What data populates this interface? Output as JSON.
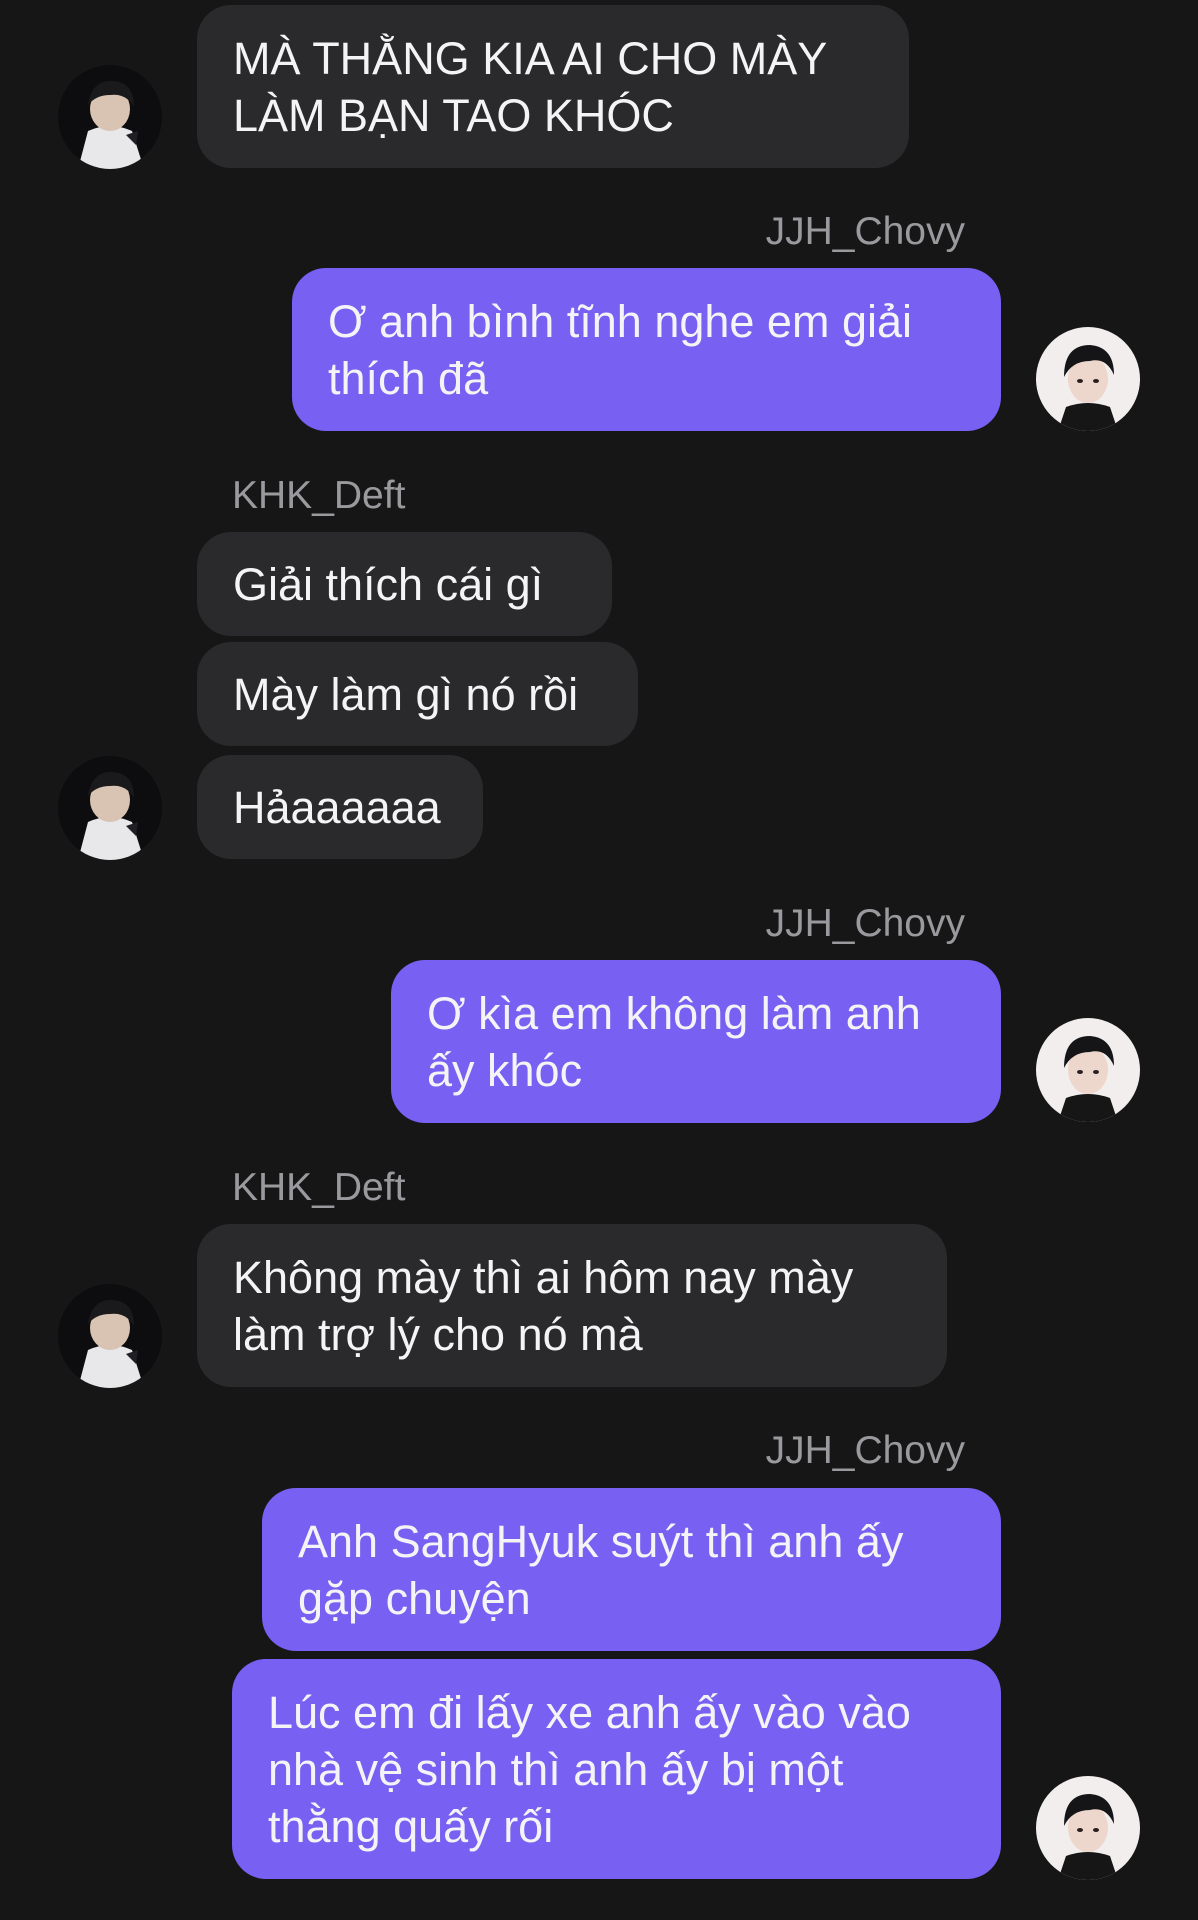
{
  "participants": {
    "left_name": "KHK_Deft",
    "right_name": "JJH_Chovy"
  },
  "messages": [
    {
      "side": "in",
      "text": "MÀ THẰNG KIA AI CHO MÀY LÀM BẠN TAO KHÓC"
    },
    {
      "side": "out",
      "sender": "JJH_Chovy",
      "text": "Ơ anh bình tĩnh nghe em giải thích đã"
    },
    {
      "side": "in",
      "sender": "KHK_Deft",
      "text": "Giải thích cái gì"
    },
    {
      "side": "in",
      "text": "Mày làm gì nó rồi"
    },
    {
      "side": "in",
      "text": "Hảaaaaaa"
    },
    {
      "side": "out",
      "sender": "JJH_Chovy",
      "text": "Ơ kìa em không làm anh ấy khóc"
    },
    {
      "side": "in",
      "sender": "KHK_Deft",
      "text": "Không mày thì ai hôm nay mày làm trợ lý cho nó mà"
    },
    {
      "side": "out",
      "sender": "JJH_Chovy",
      "text": "Anh SangHyuk suýt thì anh ấy gặp chuyện"
    },
    {
      "side": "out",
      "text": "Lúc em đi lấy xe anh ấy vào vào nhà vệ sinh thì anh ấy bị một thằng quấy rối"
    }
  ],
  "colors": {
    "background": "#161617",
    "incoming_bubble": "#2a2a2c",
    "outgoing_bubble": "#7760f2",
    "text": "#f4f4f6",
    "sender_label": "#9a9a9e"
  }
}
